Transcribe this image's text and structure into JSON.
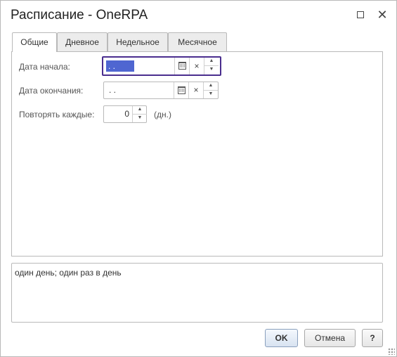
{
  "window": {
    "title": "Расписание - OneRPA"
  },
  "tabs": [
    {
      "label": "Общие",
      "active": true
    },
    {
      "label": "Дневное",
      "active": false
    },
    {
      "label": "Недельное",
      "active": false
    },
    {
      "label": "Месячное",
      "active": false
    }
  ],
  "form": {
    "start_label": "Дата начала:",
    "start_value": " .  .",
    "end_label": "Дата окончания:",
    "end_value": " .  .",
    "repeat_label": "Повторять каждые:",
    "repeat_value": "0",
    "repeat_unit": "(дн.)",
    "clear_glyph": "×"
  },
  "summary": "один день; один раз в день",
  "buttons": {
    "ok": "OK",
    "cancel": "Отмена",
    "help": "?"
  },
  "colors": {
    "focus_border": "#4a2e8e",
    "selection": "#4f66d1"
  }
}
